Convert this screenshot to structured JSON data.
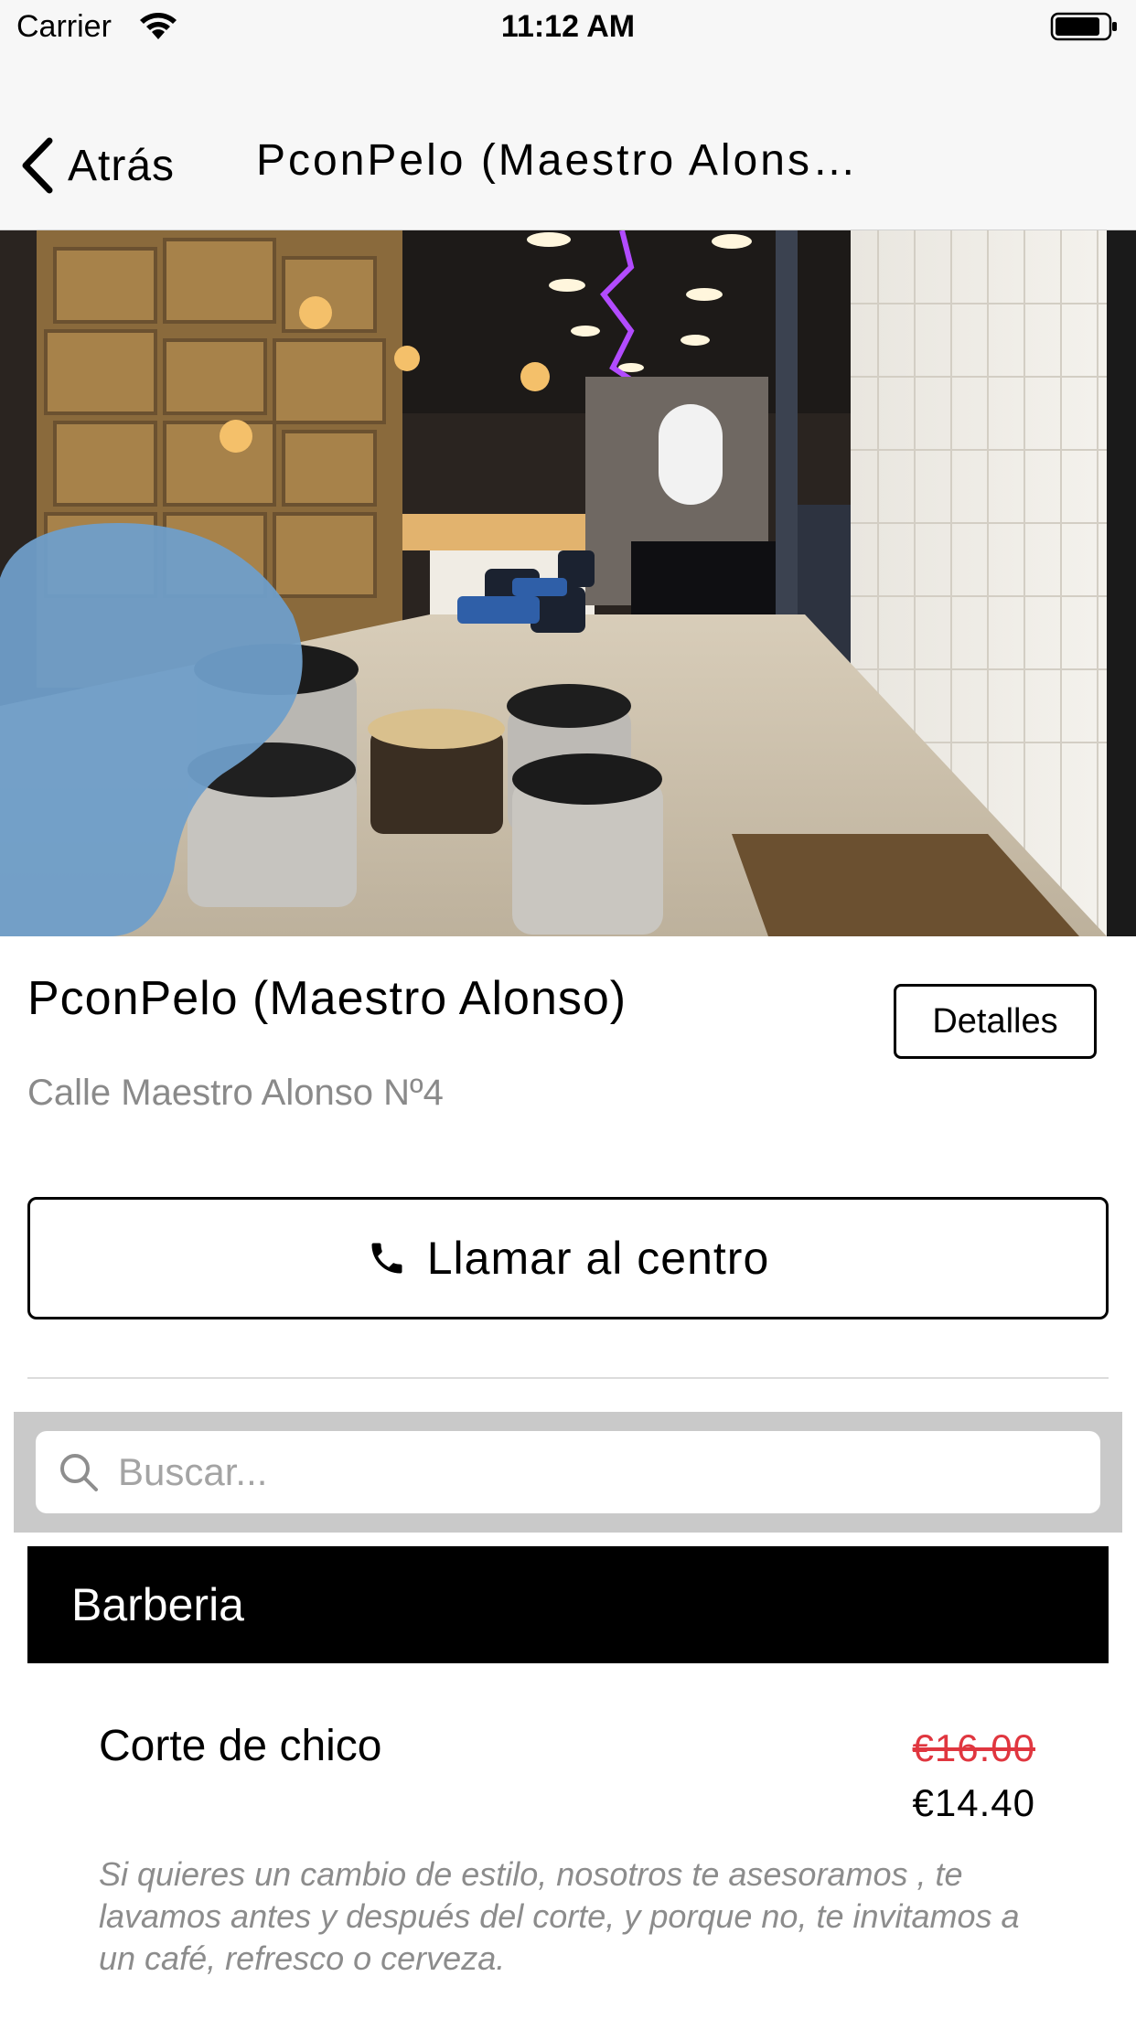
{
  "status_bar": {
    "carrier": "Carrier",
    "time": "11:12 AM",
    "wifi_icon": "wifi-icon",
    "battery_icon": "battery-icon"
  },
  "nav": {
    "back_label": "Atrás",
    "back_icon": "chevron-left-icon",
    "title": "PconPelo (Maestro Alons…"
  },
  "hero": {
    "description_icon": "salon-photo"
  },
  "shop": {
    "name": "PconPelo (Maestro Alonso)",
    "address": "Calle Maestro Alonso Nº4",
    "details_label": "Detalles",
    "call_label": "Llamar al centro",
    "call_icon": "phone-icon"
  },
  "search": {
    "placeholder": "Buscar...",
    "value": "",
    "icon": "search-icon"
  },
  "category": {
    "label": "Barberia"
  },
  "services": [
    {
      "name": "Corte de chico",
      "old_price": "€16.00",
      "price": "€14.40",
      "description": "Si quieres un cambio de estilo, nosotros te asesoramos , te lavamos antes y después del corte, y porque no, te invitamos a un café, refresco o cerveza."
    }
  ],
  "colors": {
    "nav_background": "#f7f7f7",
    "category_background": "#000000",
    "old_price": "#e0363f",
    "secondary_text": "#8a8a8a"
  }
}
